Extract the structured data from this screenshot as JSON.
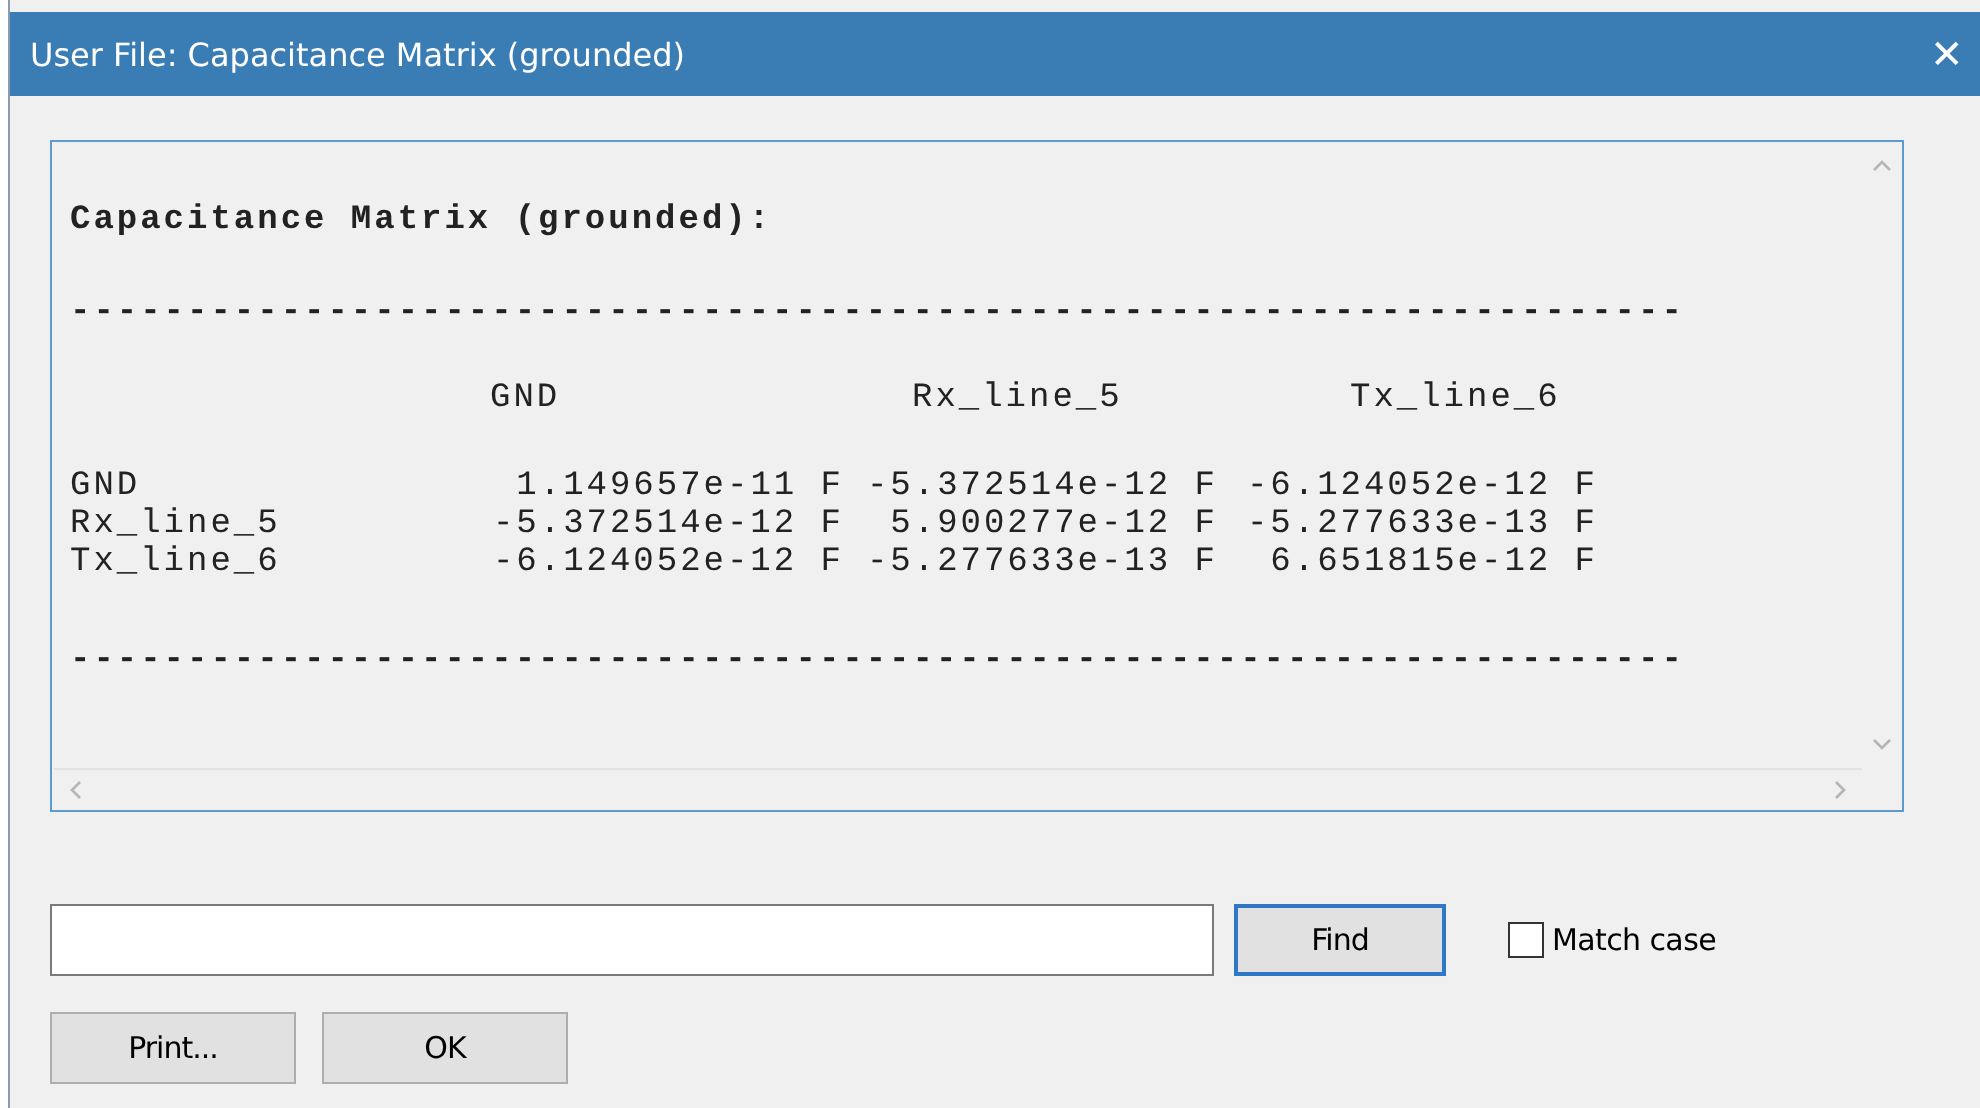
{
  "window": {
    "title": "User File: Capacitance Matrix (grounded)",
    "close": "✕"
  },
  "output": {
    "heading": "Capacitance Matrix (grounded):",
    "separator_top": "---------------------------------------------------------------------",
    "columns": [
      "GND",
      "Rx_line_5",
      "Tx_line_6"
    ],
    "rows": [
      {
        "name": "GND",
        "values": [
          "1.149657e-11 F",
          "-5.372514e-12 F",
          "-6.124052e-12 F"
        ]
      },
      {
        "name": "Rx_line_5",
        "values": [
          "-5.372514e-12 F",
          "5.900277e-12 F",
          "-5.277633e-13 F"
        ]
      },
      {
        "name": "Tx_line_6",
        "values": [
          "-6.124052e-12 F",
          "-5.277633e-13 F",
          "6.651815e-12 F"
        ]
      }
    ],
    "separator_bottom": "---------------------------------------------------------------------"
  },
  "find": {
    "button": "Find",
    "match_case": {
      "label": "Match case",
      "checked": false
    }
  },
  "buttons": [
    "Print...",
    "OK"
  ]
}
